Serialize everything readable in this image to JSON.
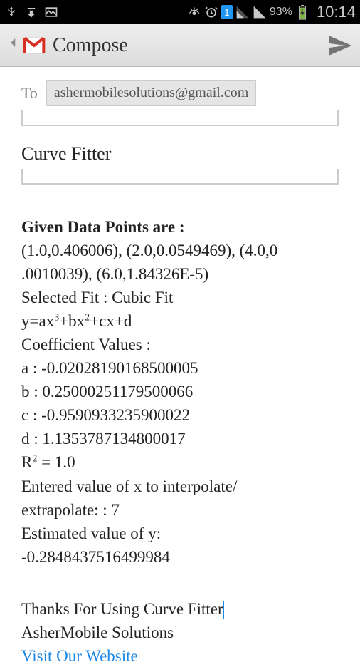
{
  "status": {
    "time": "10:14",
    "battery": "93%"
  },
  "appbar": {
    "title": "Compose"
  },
  "compose": {
    "to_label": "To",
    "to_value": "ashermobilesolutions@gmail.com",
    "subject": "Curve Fitter"
  },
  "body": {
    "heading": "Given Data Points are :",
    "points_line1": "(1.0,0.406006), (2.0,0.0549469), (4.0,0",
    "points_line2": ".0010039), (6.0,1.84326E-5)",
    "fit": "Selected Fit : Cubic Fit",
    "equation": "y=ax³+bx²+cx+d",
    "coeff_heading": "Coefficient Values :",
    "a": "a : -0.02028190168500005",
    "b": "b : 0.25000251179500066",
    "c": "c : -0.9590933235900022",
    "d": "d : 1.1353787134800017",
    "r2": "R² = 1.0",
    "interp1": "Entered value of x to interpolate/",
    "interp2": "extrapolate: : 7",
    "est1": "Estimated value of y:",
    "est2": "-0.2848437516499984",
    "thanks": "Thanks For Using Curve Fitter",
    "company": "AsherMobile Solutions",
    "link": "Visit Our Website"
  }
}
